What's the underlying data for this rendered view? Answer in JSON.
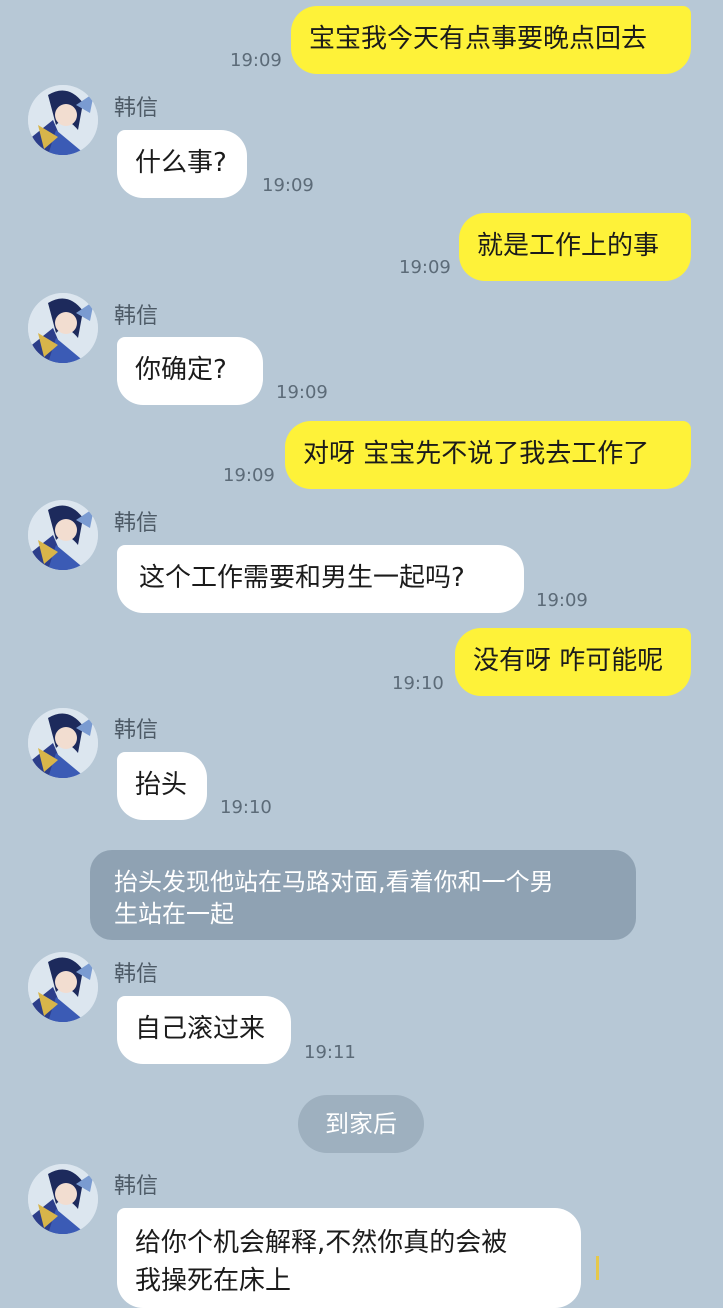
{
  "contact_name": "韩信",
  "messages": [
    {
      "text": "宝宝我今天有点事要晚点回去",
      "time": "19:09"
    },
    {
      "text": "什么事?",
      "time": "19:09"
    },
    {
      "text": "就是工作上的事",
      "time": "19:09"
    },
    {
      "text": "你确定?",
      "time": "19:09"
    },
    {
      "text": "对呀 宝宝先不说了我去工作了",
      "time": "19:09"
    },
    {
      "text": "这个工作需要和男生一起吗?",
      "time": "19:09"
    },
    {
      "text": "没有呀 咋可能呢",
      "time": "19:10"
    },
    {
      "text": "抬头",
      "time": "19:10"
    },
    {
      "text": "自己滚过来",
      "time": "19:11"
    },
    {
      "text": "给你个机会解释,不然你真的会被",
      "text2": "我操死在床上"
    }
  ],
  "narration": {
    "line1": "抬头发现他站在马路对面,看着你和一个男",
    "line2": "生站在一起"
  },
  "divider": "到家后",
  "colors": {
    "background": "#b7c8d6",
    "my_bubble": "#fef239",
    "their_bubble": "#ffffff"
  },
  "icons": {
    "avatar": "anime-hero-avatar-icon"
  }
}
